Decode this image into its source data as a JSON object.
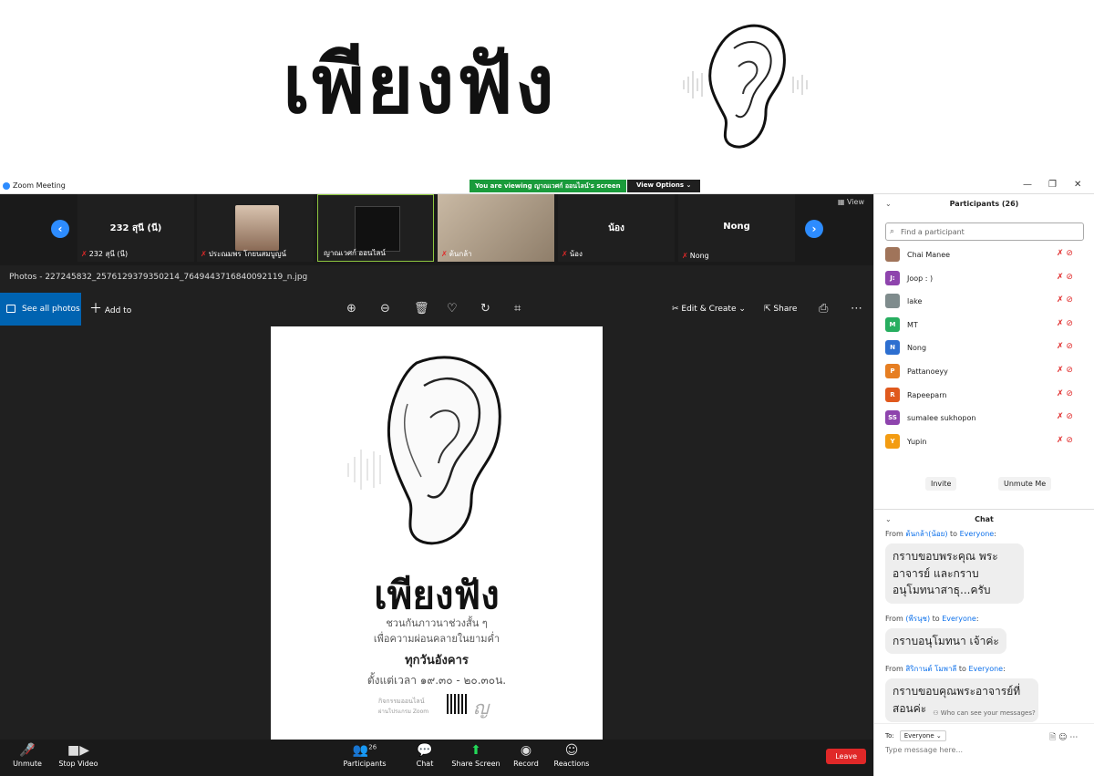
{
  "banner": {
    "title": "เพียงฟัง"
  },
  "titlebar": {
    "app_title": "Zoom Meeting",
    "viewing": "You are viewing ญาณเวศก์ ออนไลน์'s screen",
    "view_options": "View Options ⌄"
  },
  "strip": {
    "view_label": "View",
    "tiles": [
      {
        "big": "232 สุนี (นี)",
        "name": "232 สุนี (นี)"
      },
      {
        "big": "",
        "name": "ประณมพร โกยนสมบูญน์"
      },
      {
        "big": "",
        "name": "ญาณเวศก์ ออนไลน์"
      },
      {
        "big": "",
        "name": "ต้นกล้า"
      },
      {
        "big": "น้อง",
        "name": "น้อง"
      },
      {
        "big": "Nong",
        "name": "Nong"
      }
    ]
  },
  "photos": {
    "title": "Photos - 227245832_2576129379350214_7649443716840092119_n.jpg",
    "see_all": "See all photos",
    "add_to": "Add to",
    "edit_create": "Edit & Create",
    "share": "Share"
  },
  "poster": {
    "title": "เพียงฟัง",
    "line1": "ชวนกันภาวนาช่วงสั้น ๆ",
    "line2": "เพื่อความผ่อนคลายในยามค่ำ",
    "line3": "ทุกวันอังคาร",
    "line4": "ตั้งแต่เวลา ๑๙.๓๐ - ๒๐.๓๐น.",
    "line5": "กิจกรรมออนไลน์",
    "line6": "ผ่านโปรแกรม Zoom"
  },
  "controls": {
    "unmute": "Unmute",
    "stop_video": "Stop Video",
    "participants": "Participants",
    "participants_count": "26",
    "chat": "Chat",
    "share_screen": "Share Screen",
    "record": "Record",
    "reactions": "Reactions",
    "leave": "Leave"
  },
  "panel": {
    "participants_title": "Participants (26)",
    "find_placeholder": "Find a participant",
    "participants": [
      {
        "initial": "",
        "name": "Chai Manee",
        "color": "#a0745a"
      },
      {
        "initial": "J:",
        "name": "Joop : )",
        "color": "#8e44ad"
      },
      {
        "initial": "",
        "name": "lake",
        "color": "#7f8c8d"
      },
      {
        "initial": "M",
        "name": "MT",
        "color": "#27ae60"
      },
      {
        "initial": "N",
        "name": "Nong",
        "color": "#2d6fd0"
      },
      {
        "initial": "P",
        "name": "Pattanoeyy",
        "color": "#e67e22"
      },
      {
        "initial": "R",
        "name": "Rapeeparn",
        "color": "#e0591d"
      },
      {
        "initial": "SS",
        "name": "sumalee sukhopon",
        "color": "#8e44ad"
      },
      {
        "initial": "Y",
        "name": "Yupin",
        "color": "#f39c12"
      }
    ],
    "invite": "Invite",
    "unmute_me": "Unmute Me",
    "chat_title": "Chat",
    "messages": [
      {
        "from": "ต้นกล้า(น้อย)",
        "to": "Everyone",
        "text": "กราบขอบพระคุณ พระอาจารย์ และกราบอนุโมทนาสาธุ...ครับ"
      },
      {
        "from": "(พีรนุช)",
        "to": "Everyone",
        "text": "กราบอนุโมทนา เจ้าค่ะ"
      },
      {
        "from": "สิริกานต์ โมพาลี",
        "to": "Everyone",
        "text": "กราบขอบคุณพระอาจารย์ที่สอนค่ะ"
      }
    ],
    "from_label": "From",
    "to_word": "to",
    "who_can_see": "Who can see your messages?",
    "to_label": "To:",
    "to_value": "Everyone ⌄",
    "type_placeholder": "Type message here..."
  }
}
